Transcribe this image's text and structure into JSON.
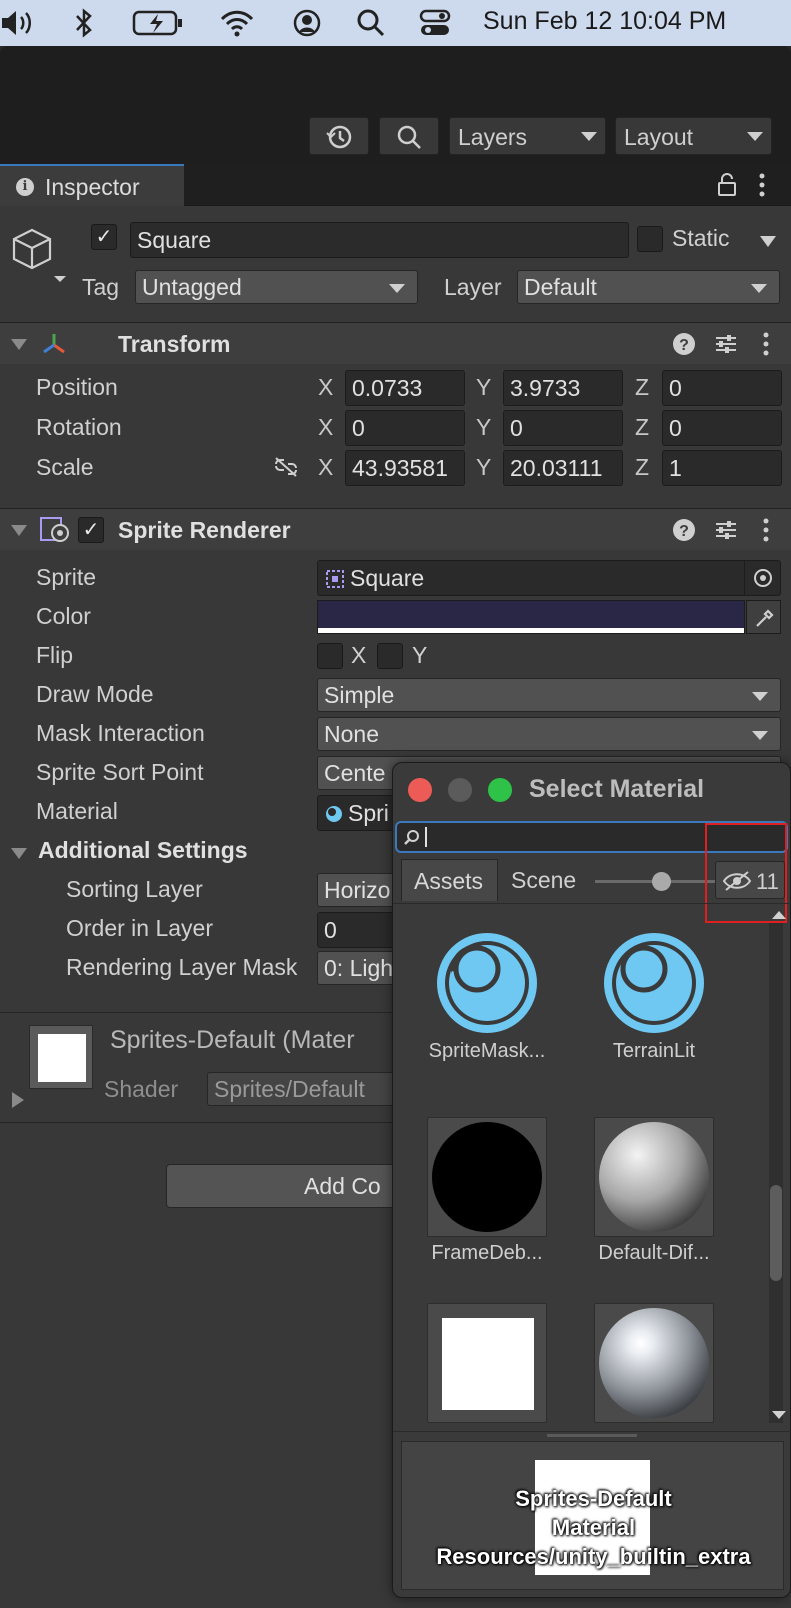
{
  "menubar": {
    "clock": "Sun Feb 12  10:04 PM",
    "icons": [
      "volume-icon",
      "bluetooth-icon",
      "battery-icon",
      "wifi-icon",
      "user-icon",
      "search-icon",
      "control-center-icon"
    ]
  },
  "toolbar": {
    "layers_label": "Layers",
    "layout_label": "Layout"
  },
  "inspector": {
    "tab_label": "Inspector",
    "object": {
      "name": "Square",
      "static_label": "Static",
      "tag_label": "Tag",
      "tag_value": "Untagged",
      "layer_label": "Layer",
      "layer_value": "Default"
    },
    "transform": {
      "title": "Transform",
      "position_label": "Position",
      "rotation_label": "Rotation",
      "scale_label": "Scale",
      "position": {
        "x": "0.0733",
        "y": "3.9733",
        "z": "0"
      },
      "rotation": {
        "x": "0",
        "y": "0",
        "z": "0"
      },
      "scale": {
        "x": "43.93581",
        "y": "20.03111",
        "z": "1"
      },
      "axis_x": "X",
      "axis_y": "Y",
      "axis_z": "Z"
    },
    "sprite_renderer": {
      "title": "Sprite Renderer",
      "sprite_label": "Sprite",
      "sprite_value": "Square",
      "color_label": "Color",
      "color_value": "#2a2746",
      "flip_label": "Flip",
      "flip_x": "X",
      "flip_y": "Y",
      "draw_mode_label": "Draw Mode",
      "draw_mode_value": "Simple",
      "mask_label": "Mask Interaction",
      "mask_value": "None",
      "sort_point_label": "Sprite Sort Point",
      "sort_point_value": "Cente",
      "material_label": "Material",
      "material_value": "Spri",
      "additional_label": "Additional Settings",
      "sorting_layer_label": "Sorting Layer",
      "sorting_layer_value": "Horizo",
      "order_label": "Order in Layer",
      "order_value": "0",
      "rendering_mask_label": "Rendering Layer Mask",
      "rendering_mask_value": "0: Ligh"
    },
    "material_preview": {
      "name": "Sprites-Default (Mater",
      "shader_label": "Shader",
      "shader_value": "Sprites/Default"
    },
    "add_component_label": "Add Co"
  },
  "popup": {
    "title": "Select Material",
    "search_value": "",
    "tab_assets": "Assets",
    "tab_scene": "Scene",
    "hidden_count": "11",
    "slider_level": 0.55,
    "items": [
      {
        "label": "SpriteMask...",
        "kind": "shader-icon"
      },
      {
        "label": "TerrainLit",
        "kind": "shader-icon"
      },
      {
        "label": "FrameDeb...",
        "kind": "black-sphere"
      },
      {
        "label": "Default-Dif...",
        "kind": "grey-sphere"
      },
      {
        "label": "",
        "kind": "white-square"
      },
      {
        "label": "",
        "kind": "shiny-sphere"
      }
    ],
    "details": {
      "line1": "Sprites-Default",
      "line2": "Material",
      "line3": "Resources/unity_builtin_extra"
    }
  }
}
